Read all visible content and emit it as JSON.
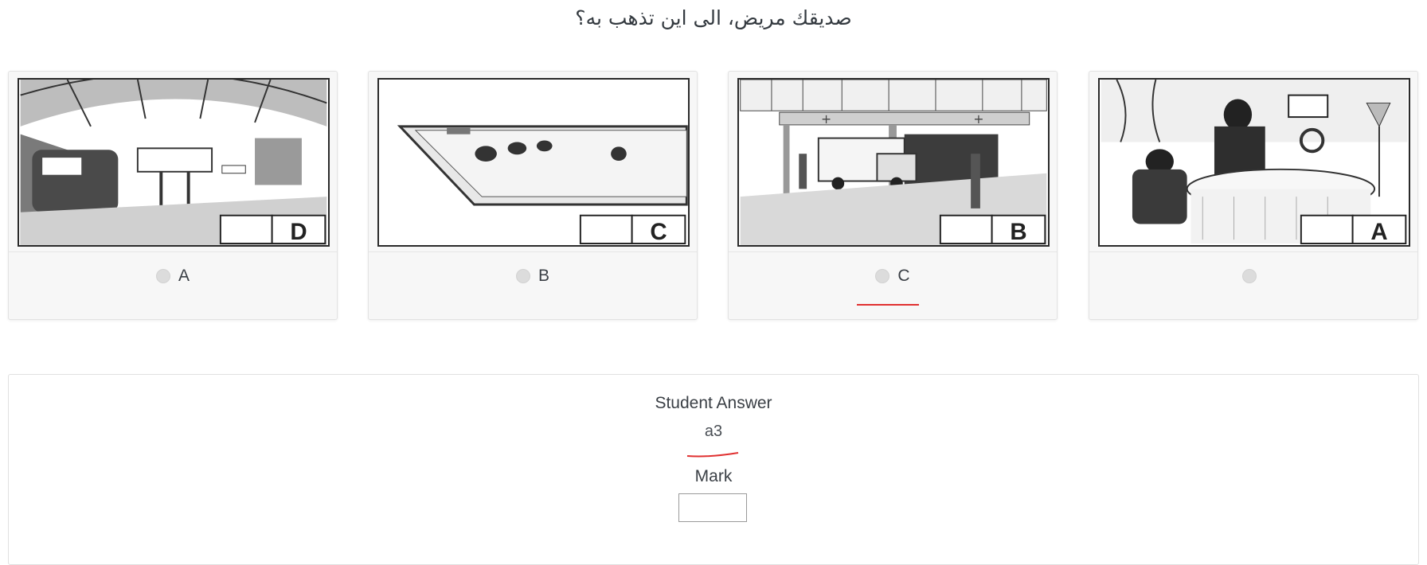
{
  "question": "صديقك مريض، الى اين تذهب به؟",
  "options": [
    {
      "label": "A",
      "picture_letter": "D",
      "scene": "train-station"
    },
    {
      "label": "B",
      "picture_letter": "C",
      "scene": "swimming-pool"
    },
    {
      "label": "C",
      "picture_letter": "B",
      "scene": "hospital"
    },
    {
      "label": "",
      "picture_letter": "A",
      "scene": "restaurant"
    }
  ],
  "review": {
    "student_answer_label": "Student Answer",
    "student_answer_value": "a3",
    "mark_label": "Mark",
    "mark_value": ""
  },
  "colors": {
    "annotation_red": "#e03030",
    "radio_gray": "#dcdcdc",
    "card_bg": "#f7f7f7"
  }
}
